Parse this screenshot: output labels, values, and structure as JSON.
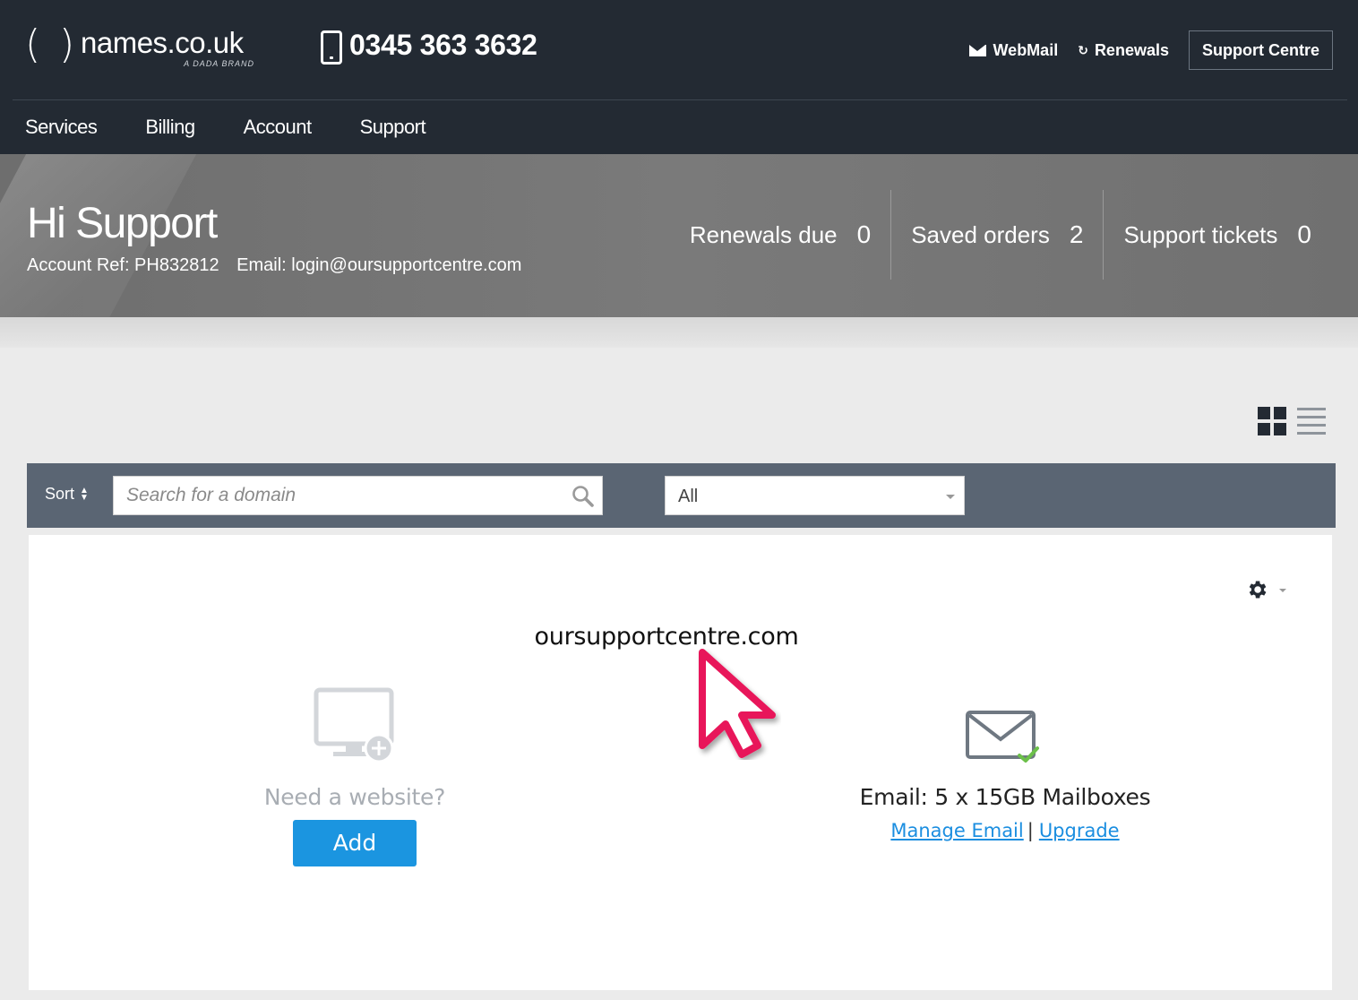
{
  "header": {
    "logo_text": "names.co.uk",
    "logo_tagline": "A DADA BRAND",
    "phone_number": "0345 363 3632",
    "links": [
      {
        "label": "WebMail",
        "icon": "envelope-icon"
      },
      {
        "label": "Renewals",
        "icon": "refresh-icon"
      }
    ],
    "support_centre_label": "Support Centre"
  },
  "nav": {
    "items": [
      {
        "label": "Services"
      },
      {
        "label": "Billing"
      },
      {
        "label": "Account"
      },
      {
        "label": "Support"
      }
    ]
  },
  "hero": {
    "greeting": "Hi Support",
    "account_ref": "Account Ref: PH832812",
    "email": "Email: login@oursupportcentre.com",
    "stats": [
      {
        "label": "Renewals due",
        "value": "0"
      },
      {
        "label": "Saved orders",
        "value": "2"
      },
      {
        "label": "Support tickets",
        "value": "0"
      }
    ]
  },
  "toolbar": {
    "sort_label": "Sort",
    "search_placeholder": "Search for a domain",
    "search_value": "",
    "filter_selected": "All"
  },
  "domain_card": {
    "domain": "oursupportcentre.com",
    "website": {
      "prompt": "Need a website?",
      "add_label": "Add"
    },
    "email": {
      "info": "Email: 5 x 15GB Mailboxes",
      "manage_label": "Manage Email",
      "separator": "|",
      "upgrade_label": "Upgrade"
    }
  },
  "colors": {
    "header_bg": "#232a33",
    "toolbar_bg": "#5a6573",
    "primary_button": "#1b95e0",
    "link": "#1b8ee0",
    "pointer": "#e8195a",
    "check": "#6cc04a"
  }
}
